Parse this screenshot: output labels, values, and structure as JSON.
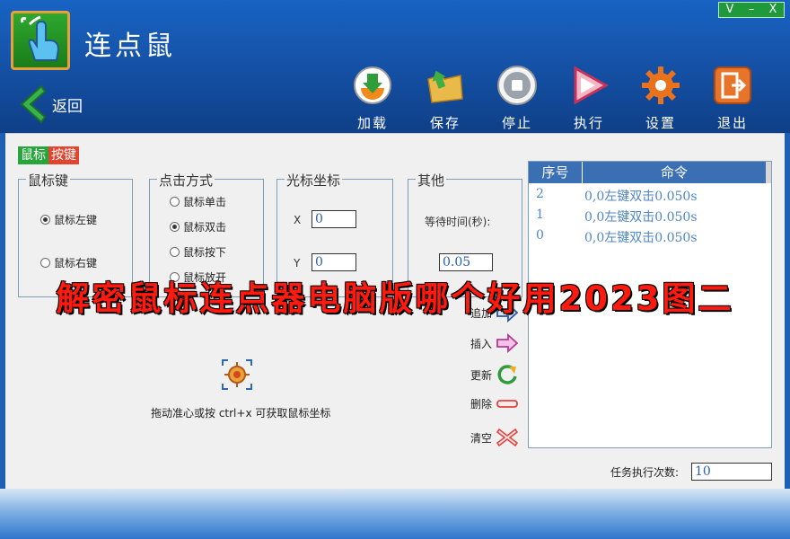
{
  "app": {
    "title": "连点鼠"
  },
  "window_controls": {
    "restore": "V",
    "minimize": "–",
    "close": "X"
  },
  "nav": {
    "back_label": "返回"
  },
  "toolbar": [
    {
      "label": "加载",
      "icon": "load-icon"
    },
    {
      "label": "保存",
      "icon": "folder-save-icon"
    },
    {
      "label": "停止",
      "icon": "stop-icon"
    },
    {
      "label": "执行",
      "icon": "play-icon"
    },
    {
      "label": "设置",
      "icon": "gear-icon"
    },
    {
      "label": "退出",
      "icon": "exit-icon"
    }
  ],
  "section_badge": {
    "part1": "鼠标",
    "part2": "按键"
  },
  "mouse_key_group": {
    "title": "鼠标键",
    "options": [
      {
        "label": "鼠标左键",
        "selected": true
      },
      {
        "label": "鼠标右键",
        "selected": false
      }
    ]
  },
  "click_mode_group": {
    "title": "点击方式",
    "options": [
      {
        "label": "鼠标单击",
        "selected": false
      },
      {
        "label": "鼠标双击",
        "selected": true
      },
      {
        "label": "鼠标按下",
        "selected": false
      },
      {
        "label": "鼠标放开",
        "selected": false
      }
    ]
  },
  "cursor_group": {
    "title": "光标坐标",
    "x_label": "X",
    "x_value": "0",
    "y_label": "Y",
    "y_value": "0"
  },
  "other_group": {
    "title": "其他",
    "wait_label": "等待时间(秒):",
    "wait_value": "0.05"
  },
  "command_list": {
    "headers": {
      "index": "序号",
      "command": "命令"
    },
    "rows": [
      {
        "index": "2",
        "command": "0,0左键双击0.050s"
      },
      {
        "index": "1",
        "command": "0,0左键双击0.050s"
      },
      {
        "index": "0",
        "command": "0,0左键双击0.050s"
      }
    ]
  },
  "side_actions": [
    {
      "label": "追加",
      "icon": "arrow-right-blue-icon"
    },
    {
      "label": "插入",
      "icon": "arrow-right-pink-icon"
    },
    {
      "label": "更新",
      "icon": "refresh-icon"
    },
    {
      "label": "删除",
      "icon": "minus-icon"
    },
    {
      "label": "清空",
      "icon": "clear-x-icon"
    }
  ],
  "crosshair": {
    "hint": "拖动准心或按 ctrl+x 可获取鼠标坐标"
  },
  "task": {
    "label": "任务执行次数:",
    "value": "10"
  },
  "watermark": "解密鼠标连点器电脑版哪个好用2023图二",
  "colors": {
    "header_blue": "#1553a9",
    "accent_green": "#26a63a",
    "accent_red": "#e0452f",
    "list_header": "#3a6fb4",
    "watermark_red": "#ff1a10"
  }
}
